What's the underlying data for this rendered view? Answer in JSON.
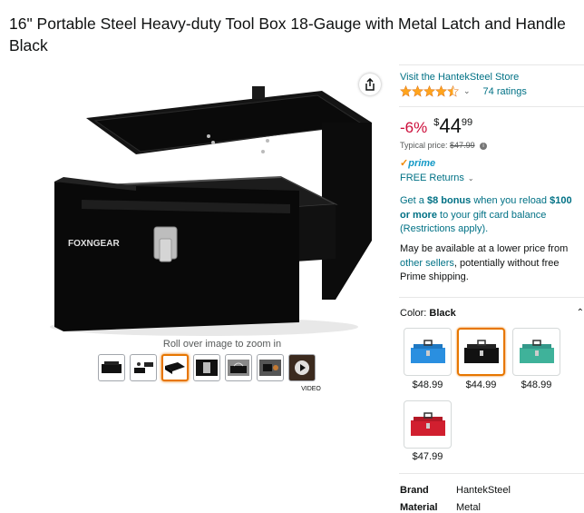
{
  "product": {
    "title": "16\" Portable Steel Heavy-duty Tool Box 18-Gauge with Metal Latch and Handle Black",
    "brand_logo": "FOXNGEAR"
  },
  "gallery": {
    "zoom_hint": "Roll over image to zoom in",
    "video_label": "VIDEO",
    "thumbnail_count": 7,
    "selected_thumbnail": 3
  },
  "store": {
    "link": "Visit the HantekSteel Store",
    "rating": 4.5,
    "rating_count": "74 ratings"
  },
  "pricing": {
    "discount": "-6%",
    "currency": "$",
    "whole": "44",
    "fraction": "99",
    "typical_label": "Typical price:",
    "typical_price": "$47.99"
  },
  "shipping": {
    "prime": "prime",
    "returns": "FREE Returns"
  },
  "bonus": {
    "part1": "Get a ",
    "amount": "$8 bonus",
    "part2": " when you reload ",
    "reload": "$100 or more",
    "part3": " to your gift card balance (Restrictions apply)."
  },
  "lower_price": {
    "part1": "May be available at a lower price from ",
    "link": "other sellers",
    "part2": ", potentially without free Prime shipping."
  },
  "color": {
    "label": "Color: ",
    "value": "Black",
    "options": [
      {
        "name": "Blue",
        "price": "$48.99",
        "color": "#2a8fe0"
      },
      {
        "name": "Black",
        "price": "$44.99",
        "color": "#111111"
      },
      {
        "name": "Green",
        "price": "$48.99",
        "color": "#3fb29a"
      },
      {
        "name": "Red",
        "price": "$47.99",
        "color": "#d11f2f"
      }
    ]
  },
  "specs": [
    {
      "key": "Brand",
      "value": "HantekSteel"
    },
    {
      "key": "Material",
      "value": "Metal"
    }
  ],
  "colors": {
    "link": "#007185",
    "discount": "#cc0c39",
    "accent": "#e77600",
    "star": "#ffa41c",
    "prime": "#1399c6"
  }
}
